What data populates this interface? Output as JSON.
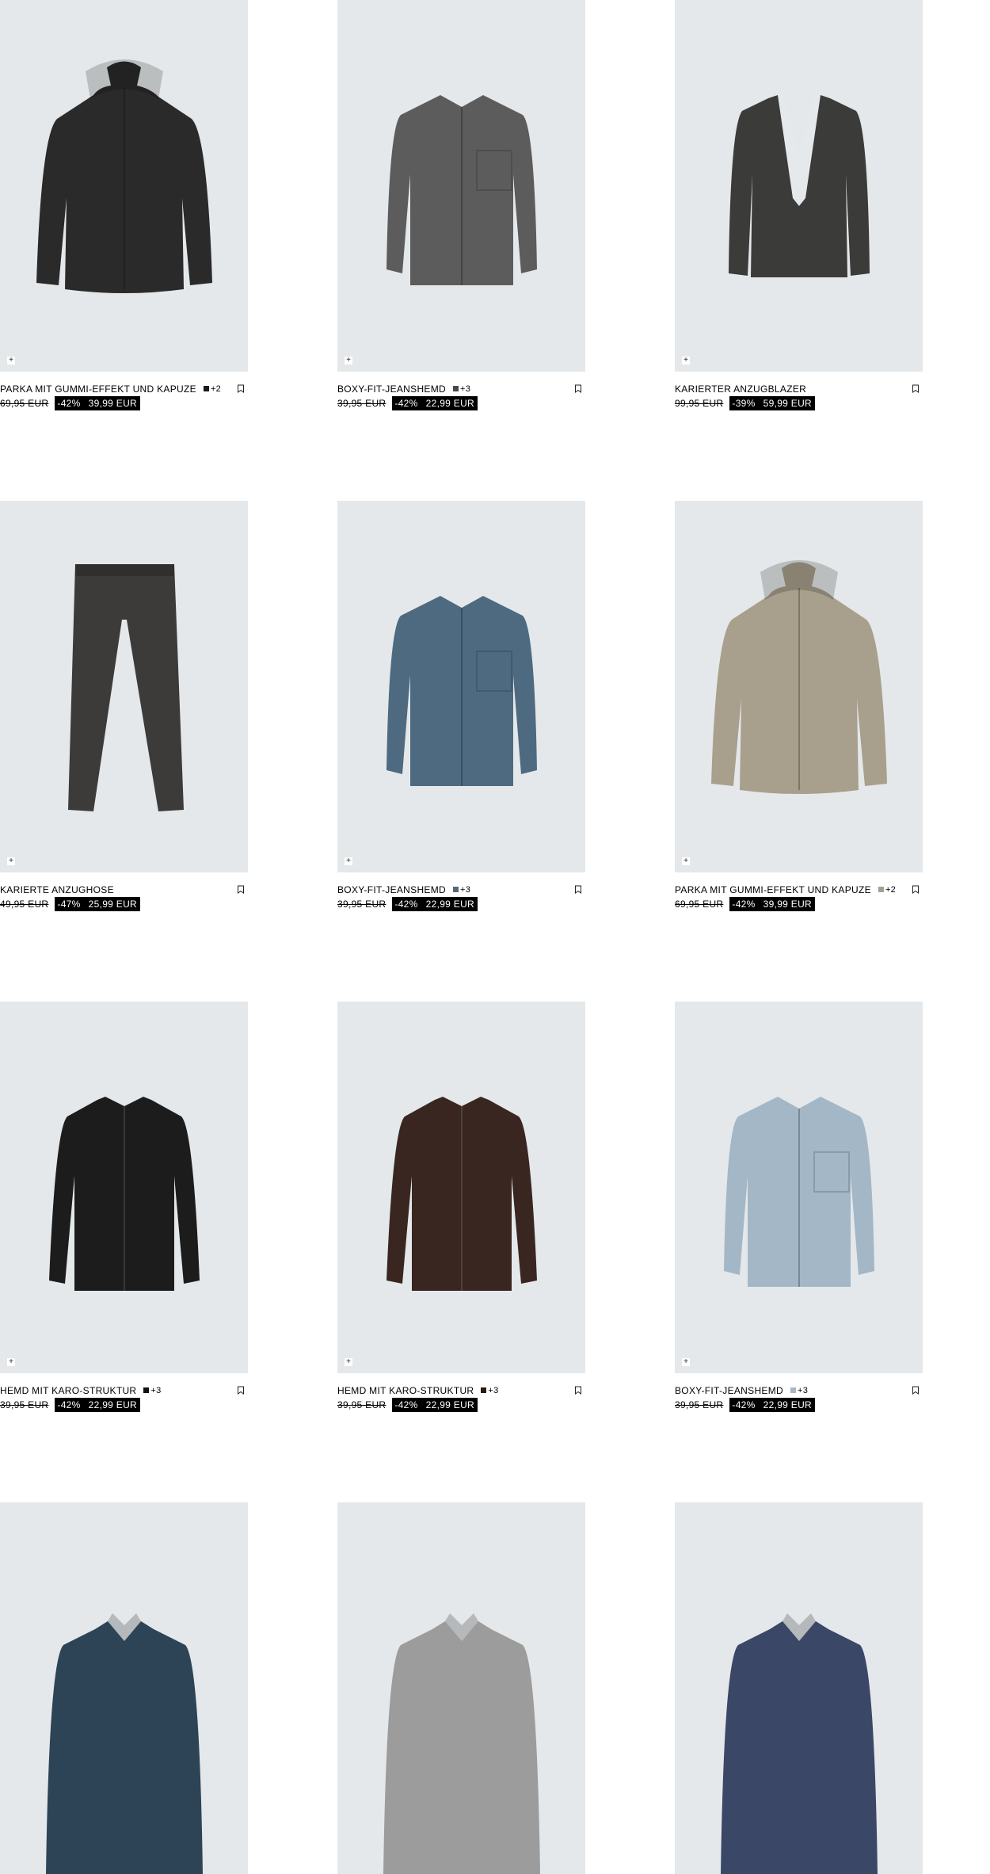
{
  "quick_add_symbol": "+",
  "rows": [
    [
      {
        "name": "PARKA MIT GUMMI-EFFEKT UND KAPUZE",
        "swatch_color": "#1a1a1a",
        "more_colors": "+2",
        "old_price": "69,95 EUR",
        "discount": "-42%",
        "price": "39,99 EUR",
        "garment": "parka",
        "garment_color": "#2a2a2a",
        "icon": "plus-icon"
      },
      {
        "name": "BOXY-FIT-JEANSHEMD",
        "swatch_color": "#4a4a4a",
        "more_colors": "+3",
        "old_price": "39,95 EUR",
        "discount": "-42%",
        "price": "22,99 EUR",
        "garment": "shirt",
        "garment_color": "#5c5c5c",
        "icon": "plus-icon"
      },
      {
        "name": "KARIERTER ANZUGBLAZER",
        "swatch_color": "",
        "more_colors": "",
        "old_price": "99,95 EUR",
        "discount": "-39%",
        "price": "59,99 EUR",
        "garment": "blazer",
        "garment_color": "#3b3b39",
        "icon": "plus-icon"
      }
    ],
    [
      {
        "name": "KARIERTE ANZUGHOSE",
        "swatch_color": "",
        "more_colors": "",
        "old_price": "49,95 EUR",
        "discount": "-47%",
        "price": "25,99 EUR",
        "garment": "trousers",
        "garment_color": "#3c3b3a",
        "icon": "plus-icon"
      },
      {
        "name": "BOXY-FIT-JEANSHEMD",
        "swatch_color": "#55697a",
        "more_colors": "+3",
        "old_price": "39,95 EUR",
        "discount": "-42%",
        "price": "22,99 EUR",
        "garment": "shirt",
        "garment_color": "#4e6a80",
        "icon": "plus-icon"
      },
      {
        "name": "PARKA MIT GUMMI-EFFEKT UND KAPUZE",
        "swatch_color": "#a59e8f",
        "more_colors": "+2",
        "old_price": "69,95 EUR",
        "discount": "-42%",
        "price": "39,99 EUR",
        "garment": "parka",
        "garment_color": "#a89f8c",
        "icon": "plus-icon"
      }
    ],
    [
      {
        "name": "HEMD MIT KARO-STRUKTUR",
        "swatch_color": "#111111",
        "more_colors": "+3",
        "old_price": "39,95 EUR",
        "discount": "-42%",
        "price": "22,99 EUR",
        "garment": "plainshirt",
        "garment_color": "#1c1c1c",
        "icon": "plus-icon"
      },
      {
        "name": "HEMD MIT KARO-STRUKTUR",
        "swatch_color": "#2a1a14",
        "more_colors": "+3",
        "old_price": "39,95 EUR",
        "discount": "-42%",
        "price": "22,99 EUR",
        "garment": "plainshirt",
        "garment_color": "#3a2620",
        "icon": "plus-icon"
      },
      {
        "name": "BOXY-FIT-JEANSHEMD",
        "swatch_color": "#a9b6c0",
        "more_colors": "+3",
        "old_price": "39,95 EUR",
        "discount": "-42%",
        "price": "22,99 EUR",
        "garment": "shirt",
        "garment_color": "#a3b7c6",
        "icon": "plus-icon"
      }
    ],
    [
      {
        "garment": "polo",
        "garment_color": "#2d4456"
      },
      {
        "garment": "polo",
        "garment_color": "#9c9c9c"
      },
      {
        "garment": "polo",
        "garment_color": "#3a4766"
      }
    ]
  ]
}
